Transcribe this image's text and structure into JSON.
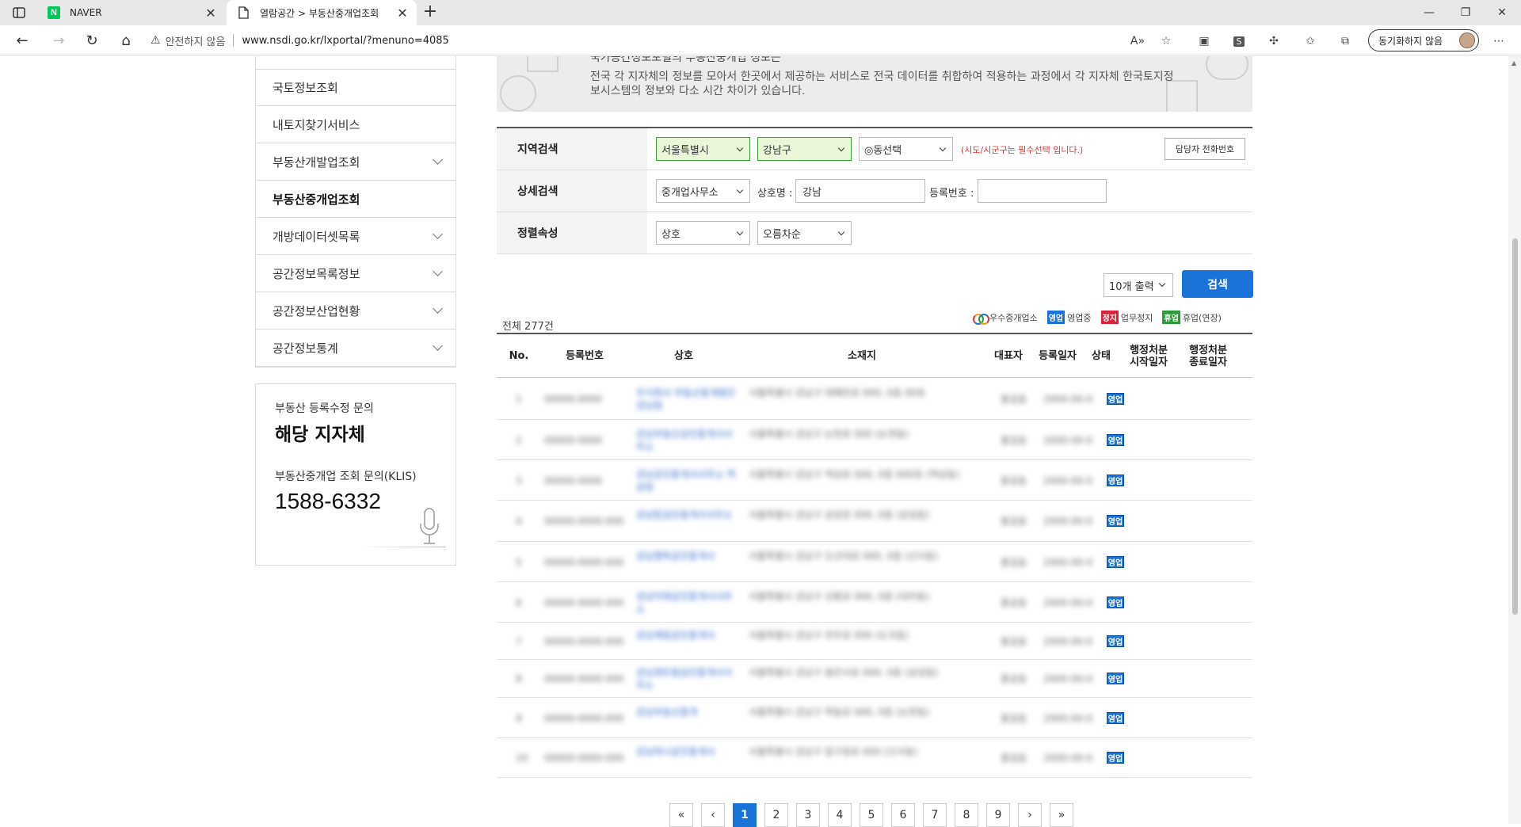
{
  "browser": {
    "tabs": [
      {
        "title": "NAVER",
        "favicon": "N"
      },
      {
        "title": "열람공간 > 부동산중개업조회"
      }
    ],
    "address": {
      "security_label": "안전하지 않음",
      "url": "www.nsdi.go.kr/lxportal/?menuno=4085"
    },
    "sync_label": "동기화하지 않음"
  },
  "sidebar": {
    "items": [
      {
        "label": "국토정보조회",
        "has_chevron": false
      },
      {
        "label": "내토지찾기서비스",
        "has_chevron": false
      },
      {
        "label": "부동산개발업조회",
        "has_chevron": true
      },
      {
        "label": "부동산중개업조회",
        "has_chevron": false,
        "active": true
      },
      {
        "label": "개방데이터셋목록",
        "has_chevron": true
      },
      {
        "label": "공간정보목록정보",
        "has_chevron": true
      },
      {
        "label": "공간정보산업현황",
        "has_chevron": true
      },
      {
        "label": "공간정보통계",
        "has_chevron": true
      }
    ],
    "contact": {
      "label1": "부동산 등록수정 문의",
      "value1": "해당 지자체",
      "label2": "부동산중개업 조회 문의(KLIS)",
      "phone": "1588-6332"
    }
  },
  "banner": {
    "partial_title": "국가공간정보포털의 부동산중개업 정보는",
    "text": "전국 각 지자체의 정보를 모아서 한곳에서 제공하는 서비스로 전국 데이터를 취합하여 적용하는 과정에서 각 지자체 한국토지정보시스템의 정보와 다소 시간 차이가 있습니다."
  },
  "search": {
    "region_label": "지역검색",
    "sido": "서울특별시",
    "sigungu": "강남구",
    "dong": "◎동선택",
    "required_note": "(시도/시군구는 필수선택 입니다.)",
    "contact_button": "담당자 전화번호",
    "detail_label": "상세검색",
    "detail_type": "중개업사무소",
    "name_label": "상호명 :",
    "name_value": "강남",
    "regno_label": "등록번호 :",
    "regno_value": "",
    "sort_label": "정렬속성",
    "sort_field": "상호",
    "sort_order": "오름차순",
    "count_select": "10개 출력",
    "search_button": "검색"
  },
  "results": {
    "total": "전체 277건",
    "legend": [
      {
        "badge": "",
        "label": "우수중개업소",
        "color": ""
      },
      {
        "badge": "영업",
        "label": "영업중",
        "color": "#1a73d9"
      },
      {
        "badge": "정지",
        "label": "업무정지",
        "color": "#d6243b"
      },
      {
        "badge": "휴업",
        "label": "휴업(연장)",
        "color": "#2d9a3c"
      }
    ],
    "columns": [
      "No.",
      "등록번호",
      "상호",
      "소재지",
      "대표자",
      "등록일자",
      "상태",
      "행정처분 시작일자",
      "행정처분 종료일자"
    ],
    "rows": [
      {
        "no": "1",
        "reg": "00000-0000",
        "name": "주식회사 부동산중개법인 강남점",
        "addr": "서울특별시 강남구 테헤란로 000, 0층 00호",
        "rep": "홍길동",
        "date": "2000-00-00",
        "status": "영업"
      },
      {
        "no": "2",
        "reg": "00000-0000",
        "name": "강남부동산공인중개사사무소",
        "addr": "서울특별시 강남구 논현로 000 (논현동)",
        "rep": "홍길동",
        "date": "2000-00-00",
        "status": "영업"
      },
      {
        "no": "3",
        "reg": "00000-0000",
        "name": "강남공인중개사사무소 역삼점",
        "addr": "서울특별시 강남구 역삼로 000, 0층 000호 (역삼동)",
        "rep": "홍길동",
        "date": "2000-00-00",
        "status": "영업"
      },
      {
        "no": "4",
        "reg": "00000-0000-00000",
        "name": "강남탑공인중개사사무소",
        "addr": "서울특별시 강남구 삼성로 000, 0층 (삼성동)",
        "rep": "홍길동",
        "date": "2000-00-00",
        "status": "영업"
      },
      {
        "no": "5",
        "reg": "00000-0000-00000",
        "name": "강남행복공인중개사",
        "addr": "서울특별시 강남구 도산대로 000, 0층 (신사동)",
        "rep": "홍길동",
        "date": "2000-00-00",
        "status": "영업"
      },
      {
        "no": "6",
        "reg": "00000-0000-00000",
        "name": "강남미래공인중개사사무소",
        "addr": "서울특별시 강남구 선릉로 000, 0층 (대치동)",
        "rep": "홍길동",
        "date": "2000-00-00",
        "status": "영업"
      },
      {
        "no": "7",
        "reg": "00000-0000-00000",
        "name": "강남제일공인중개사",
        "addr": "서울특별시 강남구 언주로 000 (도곡동)",
        "rep": "홍길동",
        "date": "2000-00-00",
        "status": "영업"
      },
      {
        "no": "8",
        "reg": "00000-0000-00000",
        "name": "강남센트럴공인중개사사무소",
        "addr": "서울특별시 강남구 봉은사로 000, 0층 (삼성동)",
        "rep": "홍길동",
        "date": "2000-00-00",
        "status": "영업"
      },
      {
        "no": "9",
        "reg": "00000-0000-00000",
        "name": "강남부동산중개",
        "addr": "서울특별시 강남구 학동로 000, 0층 (논현동)",
        "rep": "홍길동",
        "date": "2000-00-00",
        "status": "영업"
      },
      {
        "no": "10",
        "reg": "00000-0000-00000",
        "name": "강남하나공인중개사",
        "addr": "서울특별시 강남구 압구정로 000 (신사동)",
        "rep": "홍길동",
        "date": "2000-00-00",
        "status": "영업"
      }
    ]
  },
  "pagination": {
    "pages": [
      "1",
      "2",
      "3",
      "4",
      "5",
      "6",
      "7",
      "8",
      "9"
    ],
    "current": "1"
  }
}
